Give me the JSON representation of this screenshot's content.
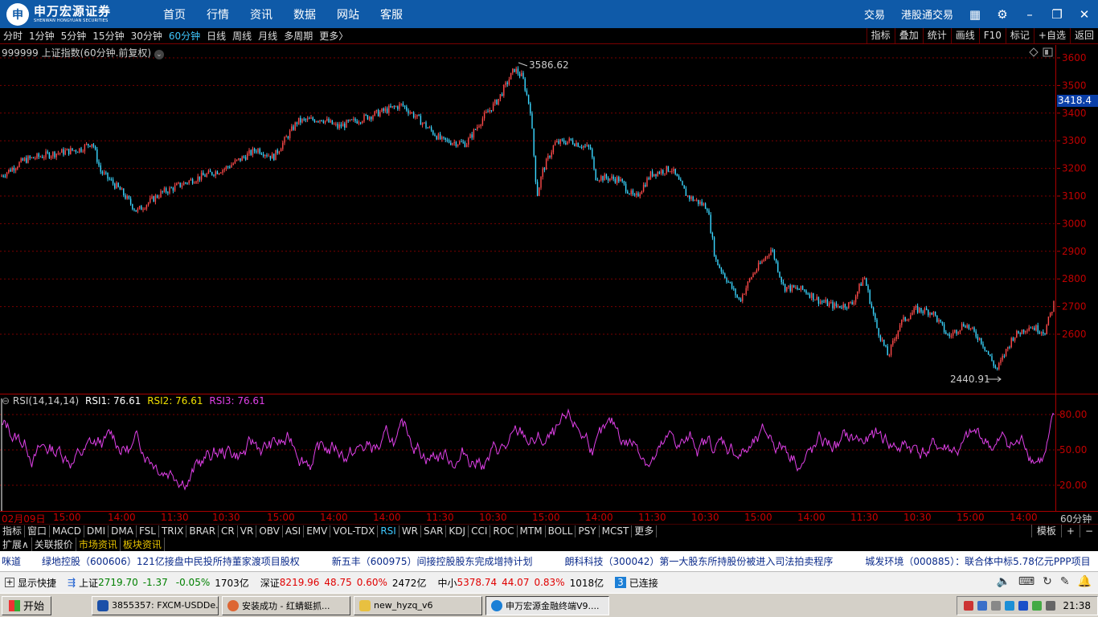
{
  "brand": {
    "cn": "申万宏源证券",
    "en": "SHENWAN HONGYUAN SECURITIES"
  },
  "topnav": [
    "首页",
    "行情",
    "资讯",
    "数据",
    "网站",
    "客服"
  ],
  "topright": [
    "交易",
    "港股通交易"
  ],
  "periods": [
    "分时",
    "1分钟",
    "5分钟",
    "15分钟",
    "30分钟",
    "60分钟",
    "日线",
    "周线",
    "月线",
    "多周期",
    "更多〉"
  ],
  "active_period": "60分钟",
  "period_tools": [
    "指标",
    "叠加",
    "统计",
    "画线",
    "F10",
    "标记",
    "+自选",
    "返回"
  ],
  "chart_title": "999999 上证指数(60分钟.前复权)",
  "current_price_tag": "3418.4",
  "max_label": "3586.62",
  "min_label": "2440.91",
  "rsi": {
    "name": "RSI(14,14,14)",
    "rsi1": "RSI1: 76.61",
    "rsi2": "RSI2: 76.61",
    "rsi3": "RSI3: 76.61"
  },
  "time_labels": [
    "02月09日",
    "15:00",
    "14:00",
    "11:30",
    "10:30",
    "15:00",
    "14:00",
    "14:00",
    "11:30",
    "10:30",
    "15:00",
    "14:00",
    "11:30",
    "10:30",
    "15:00",
    "14:00",
    "11:30",
    "10:30",
    "15:00",
    "14:00"
  ],
  "period_axis_label": "60分钟",
  "indicator_tabs": [
    "指标",
    "窗口",
    "MACD",
    "DMI",
    "DMA",
    "FSL",
    "TRIX",
    "BRAR",
    "CR",
    "VR",
    "OBV",
    "ASI",
    "EMV",
    "VOL-TDX",
    "RSI",
    "WR",
    "SAR",
    "KDJ",
    "CCI",
    "ROC",
    "MTM",
    "BOLL",
    "PSY",
    "MCST",
    "更多"
  ],
  "active_indicator": "RSI",
  "indicator_right": [
    "模板",
    "+",
    "−"
  ],
  "ext_tabs": [
    "扩展∧",
    "关联报价",
    "市场资讯",
    "板块资讯"
  ],
  "news": [
    "咪道",
    "绿地控股（600606）121亿接盘中民投所持董家渡项目股权",
    "新五丰（600975）间接控股股东完成增持计划",
    "朗科科技（300042）第一大股东所持股份被进入司法拍卖程序",
    "城发环境（000885）：联合体中标5.78亿元PPP项目"
  ],
  "status": {
    "show_shortcut": "显示快捷",
    "sh_name": "上证",
    "sh_val": "2719.70",
    "sh_chg": "-1.37",
    "sh_pct": "-0.05%",
    "sh_amt": "1703亿",
    "sz_name": "深证",
    "sz_val": "8219.96",
    "sz_chg": "48.75",
    "sz_pct": "0.60%",
    "sz_amt": "2472亿",
    "zx_name": "中小",
    "zx_val": "5378.74",
    "zx_chg": "44.07",
    "zx_pct": "0.83%",
    "zx_amt": "1018亿",
    "conn_num": "3",
    "conn": "已连接"
  },
  "taskbar": {
    "start": "开始",
    "tasks": [
      "3855357: FXCM-USDDe...",
      "安装成功 - 红蜻蜓抓...",
      "new_hyzq_v6",
      "申万宏源金融终端V9...."
    ],
    "time": "21:38"
  },
  "chart_data": {
    "type": "candlestick",
    "symbol": "999999 上证指数",
    "period": "60分钟",
    "y_ticks": [
      2600,
      2700,
      2800,
      2900,
      3000,
      3100,
      3200,
      3300,
      3400,
      3500,
      3600
    ],
    "ylim": [
      2420,
      3640
    ],
    "max": 3586.62,
    "min": 2440.91,
    "current": 3418.4,
    "close_path_keypoints": [
      [
        0,
        3170
      ],
      [
        30,
        3230
      ],
      [
        60,
        3250
      ],
      [
        100,
        3270
      ],
      [
        115,
        3295
      ],
      [
        125,
        3190
      ],
      [
        150,
        3120
      ],
      [
        170,
        3045
      ],
      [
        200,
        3110
      ],
      [
        240,
        3160
      ],
      [
        280,
        3200
      ],
      [
        320,
        3270
      ],
      [
        340,
        3240
      ],
      [
        370,
        3370
      ],
      [
        400,
        3380
      ],
      [
        420,
        3350
      ],
      [
        440,
        3370
      ],
      [
        470,
        3400
      ],
      [
        500,
        3430
      ],
      [
        520,
        3380
      ],
      [
        550,
        3300
      ],
      [
        580,
        3290
      ],
      [
        600,
        3380
      ],
      [
        620,
        3450
      ],
      [
        640,
        3560
      ],
      [
        650,
        3530
      ],
      [
        660,
        3410
      ],
      [
        668,
        3100
      ],
      [
        675,
        3190
      ],
      [
        690,
        3290
      ],
      [
        710,
        3300
      ],
      [
        735,
        3270
      ],
      [
        740,
        3170
      ],
      [
        770,
        3160
      ],
      [
        790,
        3090
      ],
      [
        810,
        3180
      ],
      [
        835,
        3200
      ],
      [
        855,
        3100
      ],
      [
        880,
        3060
      ],
      [
        890,
        2870
      ],
      [
        920,
        2720
      ],
      [
        935,
        2810
      ],
      [
        960,
        2910
      ],
      [
        975,
        2770
      ],
      [
        1000,
        2760
      ],
      [
        1020,
        2720
      ],
      [
        1040,
        2700
      ],
      [
        1060,
        2710
      ],
      [
        1075,
        2810
      ],
      [
        1090,
        2630
      ],
      [
        1105,
        2520
      ],
      [
        1120,
        2640
      ],
      [
        1140,
        2690
      ],
      [
        1160,
        2680
      ],
      [
        1180,
        2590
      ],
      [
        1200,
        2640
      ],
      [
        1220,
        2580
      ],
      [
        1240,
        2470
      ],
      [
        1260,
        2590
      ],
      [
        1280,
        2630
      ],
      [
        1300,
        2610
      ],
      [
        1312,
        2720
      ]
    ],
    "rsi_ticks": [
      20.0,
      50.0,
      80.0
    ],
    "rsi_range": [
      10,
      90
    ],
    "rsi_last": 76.61
  },
  "colors": {
    "up": "#ff4a4a",
    "down": "#3ad6ff",
    "rsi": "#e040e8",
    "grid": "#7a0000",
    "axis": "#c00000"
  }
}
